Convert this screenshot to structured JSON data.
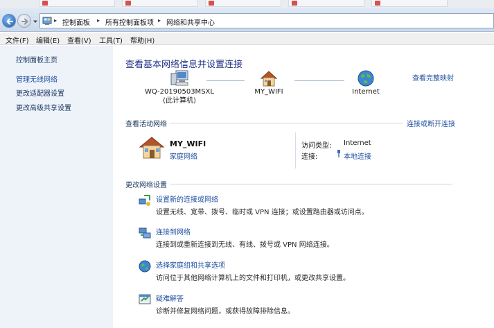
{
  "top_tabs": [
    "",
    "",
    "",
    "",
    "",
    ""
  ],
  "addressbar": {
    "crumbs": [
      "控制面板",
      "所有控制面板项",
      "网络和共享中心"
    ]
  },
  "menubar": [
    "文件(F)",
    "编辑(E)",
    "查看(V)",
    "工具(T)",
    "帮助(H)"
  ],
  "sidebar": {
    "items": [
      {
        "label": "控制面板主页"
      },
      {
        "label": "管理无线网络"
      },
      {
        "label": "更改适配器设置"
      },
      {
        "label": "更改高级共享设置"
      }
    ]
  },
  "main": {
    "title": "查看基本网络信息并设置连接",
    "see_full_map": "查看完整映射",
    "map": {
      "computer_name": "WQ-20190503MSXL",
      "computer_sub": "(此计算机)",
      "router_name": "MY_WIFI",
      "internet_name": "Internet"
    },
    "active_header": "查看活动网络",
    "connect_disconnect": "连接或断开连接",
    "network": {
      "name": "MY_WIFI",
      "type": "家庭网络",
      "access_type_label": "访问类型:",
      "access_type_value": "Internet",
      "connection_label": "连接:",
      "connection_value": "本地连接"
    },
    "change_header": "更改网络设置",
    "tasks": [
      {
        "link": "设置新的连接或网络",
        "desc": "设置无线、宽带、拨号、临时或 VPN 连接；或设置路由器或访问点。"
      },
      {
        "link": "连接到网络",
        "desc": "连接到或重新连接到无线、有线、拨号或 VPN 网络连接。"
      },
      {
        "link": "选择家庭组和共享选项",
        "desc": "访问位于其他网络计算机上的文件和打印机，或更改共享设置。"
      },
      {
        "link": "疑难解答",
        "desc": "诊断并修复网络问题，或获得故障排除信息。"
      }
    ]
  },
  "colors": {
    "link": "#1e4fa0",
    "title": "#1e3287",
    "sidebar_bg": "#eef3fa",
    "arrow": "#e0001b"
  }
}
